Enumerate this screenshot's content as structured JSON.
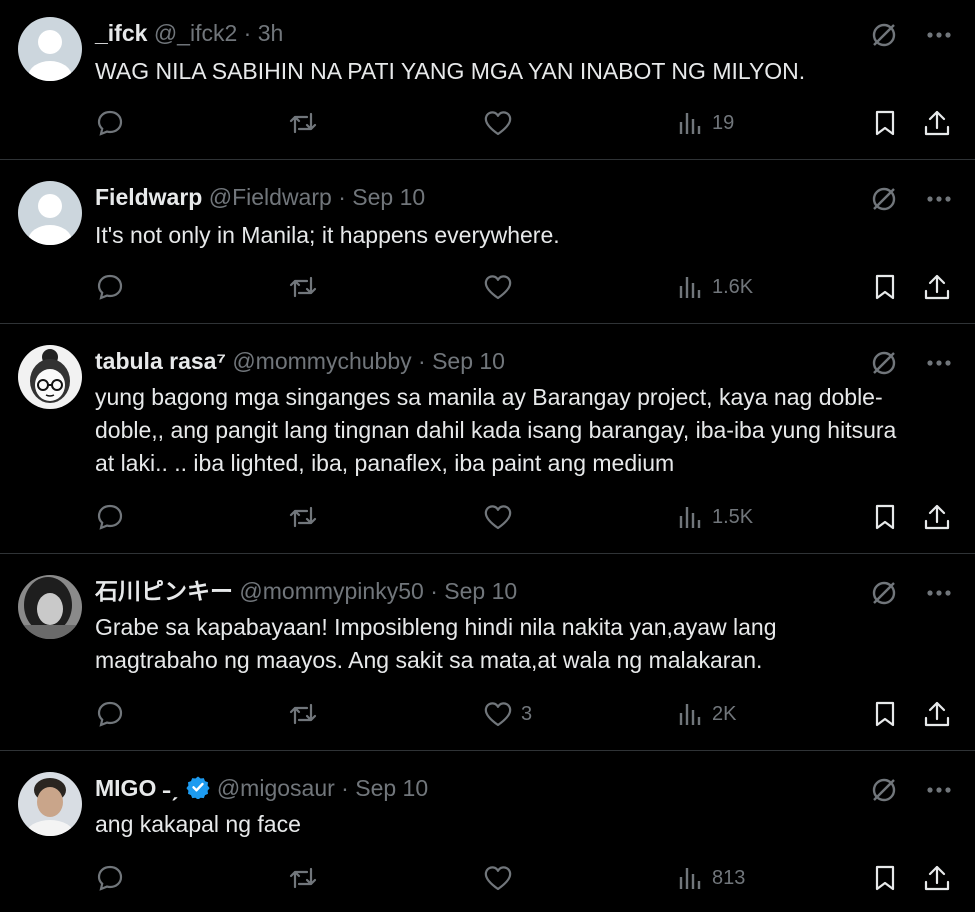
{
  "posts": [
    {
      "name": "_ifck",
      "handle": "@_ifck2",
      "time": "3h",
      "text": "WAG NILA SABIHIN NA PATI YANG MGA YAN INABOT NG MILYON.",
      "likes": "",
      "views": "19",
      "avatar": "default-avatar"
    },
    {
      "name": "Fieldwarp",
      "handle": "@Fieldwarp",
      "time": "Sep 10",
      "text": "It's not only in Manila; it happens everywhere.",
      "likes": "",
      "views": "1.6K",
      "avatar": "default-avatar"
    },
    {
      "name": "tabula rasa⁷",
      "handle": "@mommychubby",
      "time": "Sep 10",
      "text": "yung bagong mga singanges sa manila ay Barangay project, kaya nag doble-doble,, ang pangit lang tingnan dahil kada isang barangay, iba-iba yung hitsura at laki.. .. iba lighted, iba, panaflex, iba paint ang medium",
      "likes": "",
      "views": "1.5K",
      "avatar": "illustrated-avatar"
    },
    {
      "name": "石川ピンキー",
      "handle": "@mommypinky50",
      "time": "Sep 10",
      "text": "Grabe sa kapabayaan! Imposibleng hindi nila nakita yan,ayaw lang magtrabaho ng maayos. Ang sakit sa mata,at wala ng malakaran.",
      "likes": "3",
      "views": "2K",
      "avatar": "photo-avatar"
    },
    {
      "name": "MIGO ˗ˏ",
      "handle": "@migosaur",
      "time": "Sep 10",
      "text": "ang kakapal ng face",
      "likes": "",
      "views": "813",
      "avatar": "photo-avatar",
      "verified": true
    }
  ],
  "separator": "·",
  "colors": {
    "background": "#000000",
    "text": "#e7e9ea",
    "muted": "#71767b",
    "verified": "#1d9bf0",
    "divider": "#2f3336"
  }
}
